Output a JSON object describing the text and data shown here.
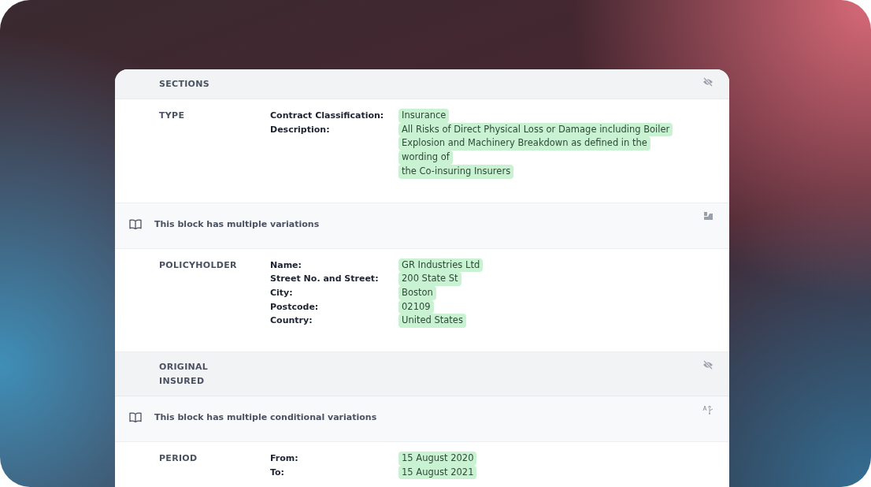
{
  "blocks": [
    {
      "kind": "header",
      "title": "SECTIONS"
    },
    {
      "kind": "fields",
      "title": "TYPE",
      "fields": [
        {
          "label": "Contract Classification:",
          "lines": [
            "Insurance"
          ]
        },
        {
          "label": "Description:",
          "lines": [
            "All Risks of Direct Physical Loss or Damage including Boiler",
            "Explosion and Machinery Breakdown as defined in the",
            "wording of",
            "the Co-insuring Insurers"
          ]
        }
      ]
    },
    {
      "kind": "notice",
      "text": "This block has multiple variations"
    },
    {
      "kind": "fields",
      "title": "POLICYHOLDER",
      "fields": [
        {
          "label": "Name:",
          "lines": [
            "GR Industries Ltd"
          ]
        },
        {
          "label": "Street No. and Street:",
          "lines": [
            "200 State St"
          ]
        },
        {
          "label": "City:",
          "lines": [
            "Boston"
          ]
        },
        {
          "label": "Postcode:",
          "lines": [
            "02109"
          ]
        },
        {
          "label": "Country:",
          "lines": [
            "United States"
          ]
        }
      ]
    },
    {
      "kind": "header",
      "title": "ORIGINAL INSURED"
    },
    {
      "kind": "notice",
      "text": "This block has multiple conditional variations"
    },
    {
      "kind": "fields",
      "title": "PERIOD",
      "fields": [
        {
          "label": "From:",
          "lines": [
            "15 August 2020"
          ]
        },
        {
          "label": "To:",
          "lines": [
            "15 August 2021"
          ]
        }
      ]
    }
  ]
}
